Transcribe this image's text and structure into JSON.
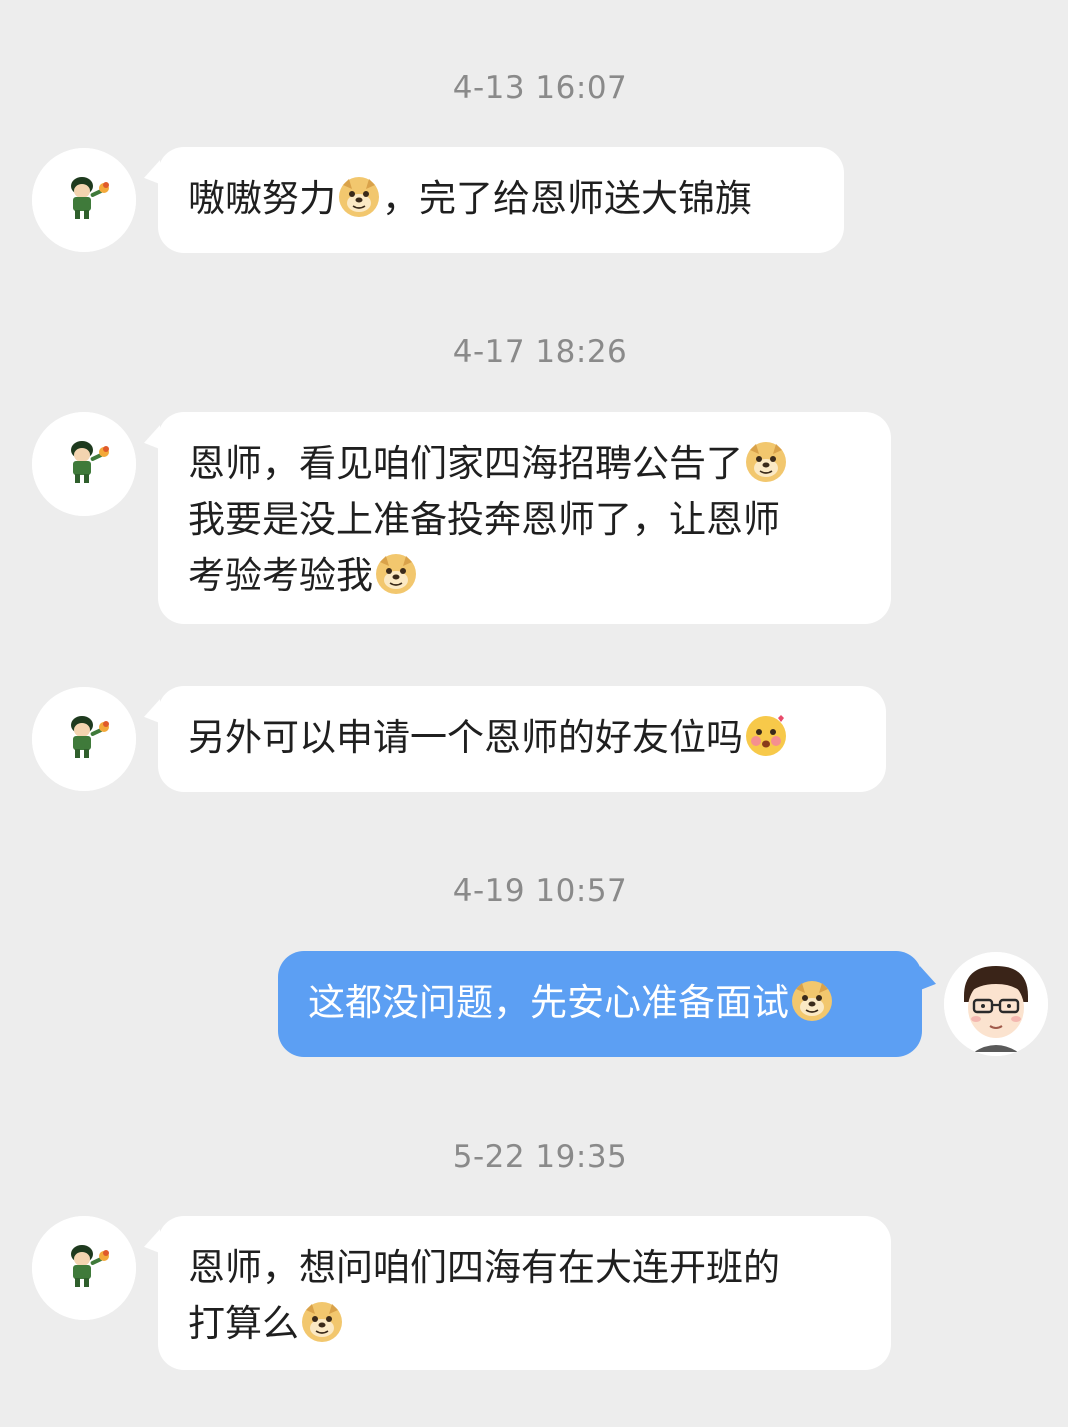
{
  "conversation": {
    "messages": [
      {
        "timestamp": "4-13 16:07",
        "sender": "contact",
        "lines": [
          {
            "parts": [
              "嗷嗷努力",
              {
                "emoji": "doge-emoji"
              },
              "，完了给恩师送大锦旗"
            ]
          }
        ]
      },
      {
        "timestamp": "4-17 18:26",
        "sender": "contact",
        "lines": [
          {
            "parts": [
              "恩师，看见咱们家四海招聘公告了",
              {
                "emoji": "doge-emoji"
              }
            ]
          },
          {
            "parts": [
              "我要是没上准备投奔恩师了，让恩师"
            ]
          },
          {
            "parts": [
              "考验考验我",
              {
                "emoji": "doge-emoji"
              }
            ]
          }
        ]
      },
      {
        "timestamp": "",
        "sender": "contact",
        "lines": [
          {
            "parts": [
              "另外可以申请一个恩师的好友位吗",
              {
                "emoji": "blush-face-emoji"
              }
            ]
          }
        ]
      },
      {
        "timestamp": "4-19 10:57",
        "sender": "me",
        "lines": [
          {
            "parts": [
              "这都没问题，先安心准备面试",
              {
                "emoji": "doge-emoji"
              }
            ]
          }
        ]
      },
      {
        "timestamp": "5-22 19:35",
        "sender": "contact",
        "lines": [
          {
            "parts": [
              "恩师，想问咱们四海有在大连开班的"
            ]
          },
          {
            "parts": [
              "打算么",
              {
                "emoji": "doge-emoji"
              }
            ]
          }
        ]
      }
    ]
  },
  "theme": {
    "background": "#ededed",
    "incoming_bubble": "#ffffff",
    "outgoing_bubble": "#5c9ff3",
    "timestamp_color": "#8a8a8a",
    "text_color": "#1f1f1f"
  },
  "icons": {
    "contact_avatar": "cartoon-character-avatar",
    "my_avatar": "glasses-man-avatar"
  }
}
